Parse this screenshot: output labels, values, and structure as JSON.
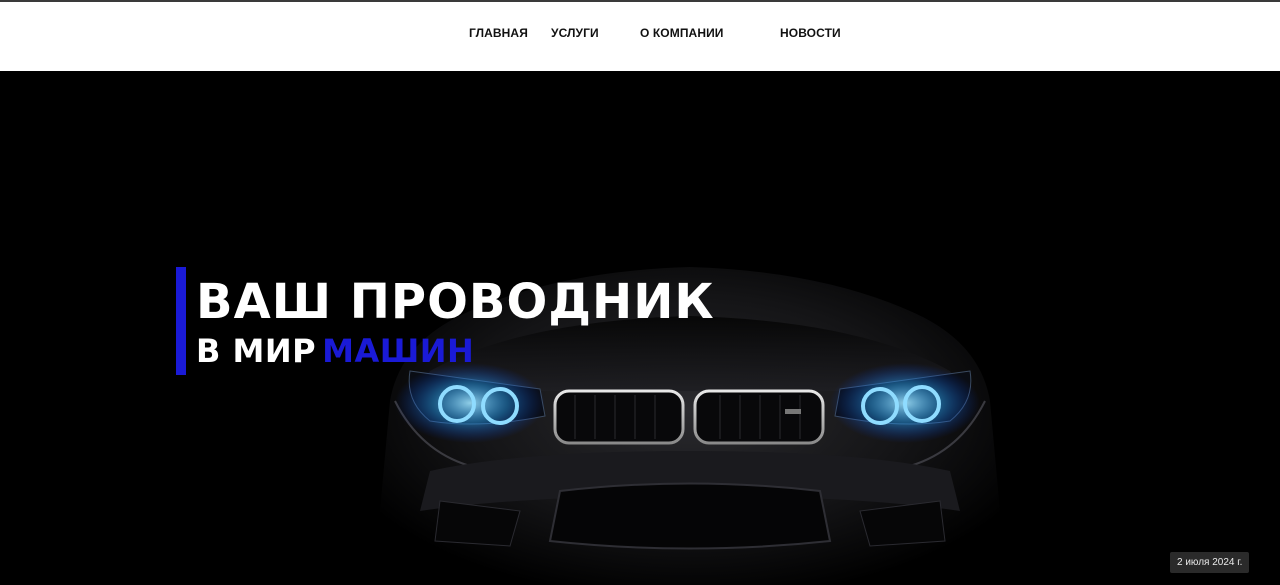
{
  "nav": {
    "items": [
      {
        "label": "ГЛАВНАЯ"
      },
      {
        "label": "УСЛУГИ"
      },
      {
        "label": "О КОМПАНИИ"
      },
      {
        "label": "НОВОСТИ"
      }
    ]
  },
  "hero": {
    "headline_line1": "ВАШ ПРОВОДНИК",
    "headline_line2_prefix": "В МИР",
    "headline_line2_highlight": "МАШИН",
    "date": "2 июля 2024 г.",
    "image": "car-front-headlights"
  },
  "colors": {
    "accent": "#1a1ad6",
    "headlight_glow": "#4fc3ff"
  }
}
